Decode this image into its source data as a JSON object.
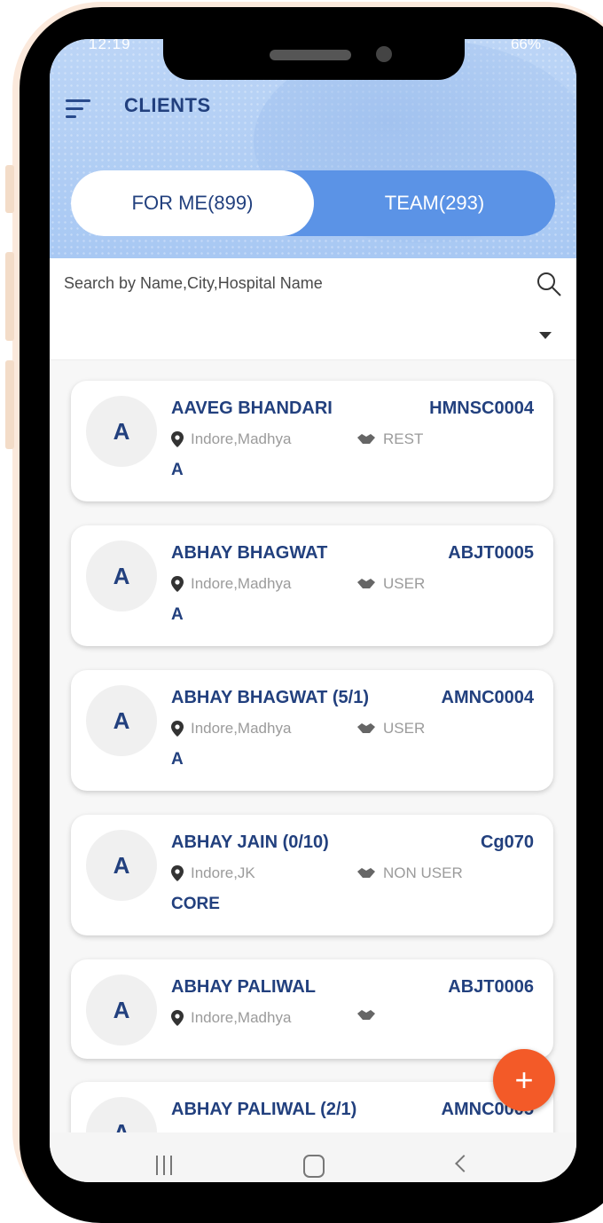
{
  "status_bar": {
    "time": "12:19",
    "battery": "66%"
  },
  "header": {
    "title": "CLIENTS"
  },
  "tabs": [
    {
      "label": "FOR ME(899)",
      "active": true
    },
    {
      "label": "TEAM(293)",
      "active": false
    }
  ],
  "search": {
    "placeholder": "Search by Name,City,Hospital Name"
  },
  "clients": [
    {
      "initial": "A",
      "name": "AAVEG BHANDARI",
      "code": "HMNSC0004",
      "location": "Indore,Madhya",
      "type": "REST",
      "tag": "A"
    },
    {
      "initial": "A",
      "name": "ABHAY BHAGWAT",
      "code": "ABJT0005",
      "location": "Indore,Madhya",
      "type": "USER",
      "tag": "A"
    },
    {
      "initial": "A",
      "name": "ABHAY BHAGWAT (5/1)",
      "code": "AMNC0004",
      "location": "Indore,Madhya",
      "type": "USER",
      "tag": "A"
    },
    {
      "initial": "A",
      "name": "ABHAY JAIN (0/10)",
      "code": "Cg070",
      "location": "Indore,JK",
      "type": "NON USER",
      "tag": "CORE"
    },
    {
      "initial": "A",
      "name": "ABHAY PALIWAL",
      "code": "ABJT0006",
      "location": "Indore,Madhya",
      "type": "",
      "tag": ""
    },
    {
      "initial": "A",
      "name": "ABHAY PALIWAL (2/1)",
      "code": "AMNC0005",
      "location": "",
      "type": "",
      "tag": ""
    }
  ],
  "fab": {
    "label": "+"
  },
  "colors": {
    "accent": "#22407e",
    "tab_bg": "#5b93e6",
    "fab": "#f35a28"
  }
}
